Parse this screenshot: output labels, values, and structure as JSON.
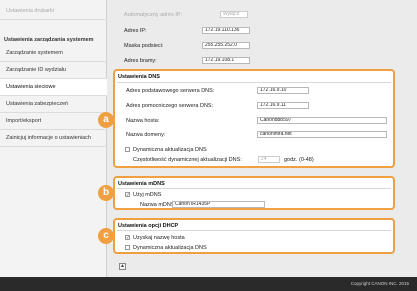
{
  "sidebar": {
    "top_item": "Ustawienia drukarki",
    "heading": "Ustawienia zarządzania systemem",
    "items": [
      "Zarządzanie systemem",
      "Zarządzanie ID wydziału",
      "Ustawienia sieciowe",
      "Ustawienia zabezpieczeń",
      "Import/eksport",
      "Zainicjuj informacje o ustawieniach"
    ]
  },
  "ip": {
    "auto_label": "Automatyczny adres IP:",
    "auto_value": "Wyłącz",
    "address_label": "Adres IP:",
    "address_value": "172.19.110.136",
    "mask_label": "Maska podsieci:",
    "mask_value": "255.255.252.0",
    "gateway_label": "Adres bramy:",
    "gateway_value": "172.19.108.1"
  },
  "dns": {
    "title": "Ustawienia DNS",
    "primary_label": "Adres podstawowego serwera DNS:",
    "primary_value": "172.16.9.10",
    "secondary_label": "Adres pomocniczego serwera DNS:",
    "secondary_value": "172.16.9.11",
    "host_label": "Nazwa hosta:",
    "host_value": "Canondbb597",
    "domain_label": "Nazwa domeny:",
    "domain_value": "canonintra.net",
    "dynamic_label": "Dynamiczna aktualizacja DNS",
    "interval_label": "Częstotliwość dynamicznej aktualizacji DNS:",
    "interval_value": "24",
    "interval_unit": "godz. (0-48)"
  },
  "mdns": {
    "title": "Ustawienia mDNS",
    "use_label": "Użyj mDNS",
    "use_check": "✓",
    "name_label": "Nazwa mDNS:",
    "name_value": "Canon iR1435P"
  },
  "dhcp": {
    "title": "Ustawienia opcji DHCP",
    "host_label": "Uzyskaj nazwę hosta",
    "host_check": "✓",
    "dynamic_label": "Dynamiczna aktualizacja DNS"
  },
  "badges": {
    "a": "a",
    "b": "b",
    "c": "c"
  },
  "scroll_glyph": "▲",
  "footer": "Copyright CANON INC. 2015",
  "colors": {
    "accent": "#f0a040",
    "footer_bg": "#2a2a2a"
  }
}
